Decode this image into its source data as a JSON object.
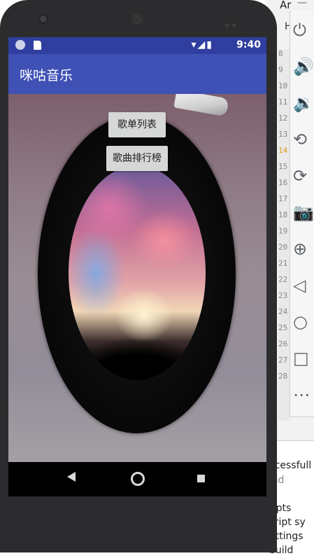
{
  "ide": {
    "top_label": "Ar",
    "top_dash": "—",
    "edge_letter": "H",
    "line_numbers": [
      "8",
      "9",
      "10",
      "11",
      "12",
      "13",
      "14",
      "15",
      "16",
      "17",
      "18",
      "19",
      "20",
      "21",
      "22",
      "23",
      "24",
      "25",
      "26",
      "27",
      "28"
    ],
    "console_lines": [
      "ccessfull",
      "oid",
      "ripts",
      "cript sy",
      "ettings",
      "build"
    ]
  },
  "emulator_tools": [
    {
      "icon": "power-icon",
      "glyph": "⏻"
    },
    {
      "icon": "volume-up-icon",
      "glyph": "🔊"
    },
    {
      "icon": "volume-down-icon",
      "glyph": "🔉"
    },
    {
      "icon": "rotate-left-icon",
      "glyph": "⟲"
    },
    {
      "icon": "rotate-right-icon",
      "glyph": "⟳"
    },
    {
      "icon": "camera-icon",
      "glyph": "📷"
    },
    {
      "icon": "zoom-icon",
      "glyph": "⊕"
    },
    {
      "icon": "back-icon",
      "glyph": "◁"
    },
    {
      "icon": "home-icon",
      "glyph": "○"
    },
    {
      "icon": "overview-icon",
      "glyph": "□"
    },
    {
      "icon": "more-icon",
      "glyph": "⋯"
    }
  ],
  "status_bar": {
    "time": "9:40",
    "icons": "▾◢▮"
  },
  "app": {
    "title": "咪咕音乐",
    "primary_color": "#3f51b5",
    "status_color": "#303f9f"
  },
  "buttons": {
    "playlist": "歌单列表",
    "ranking": "歌曲排行榜"
  },
  "nav": {
    "back": "back",
    "home": "home",
    "recent": "recents"
  }
}
